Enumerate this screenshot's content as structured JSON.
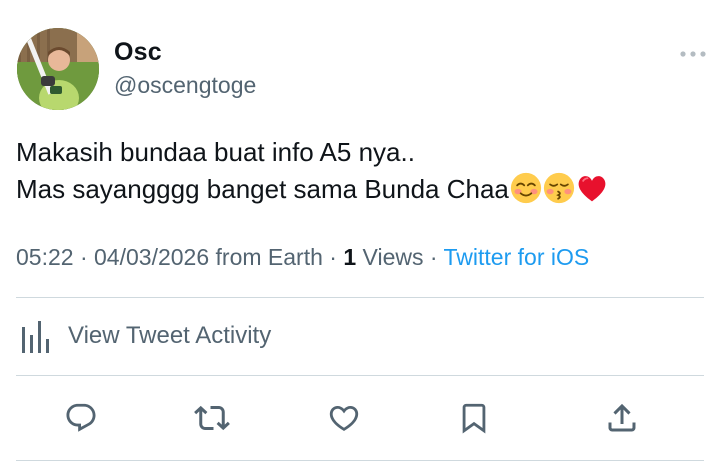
{
  "author": {
    "display_name": "Osc",
    "handle": "@oscengtoge"
  },
  "tweet": {
    "line1": "Makasih bundaa buat info A5 nya..",
    "line2": "Mas sayangggg banget sama Bunda Chaa",
    "emojis": [
      "smiling-face-emoji",
      "kissing-face-emoji",
      "red-heart-emoji"
    ]
  },
  "meta": {
    "time": "05:22",
    "separator": "·",
    "date": "04/03/2026",
    "location": "from Earth",
    "views_count": "1",
    "views_label": "Views",
    "source": "Twitter for iOS"
  },
  "activity": {
    "label": "View Tweet Activity"
  },
  "actions": [
    "reply-icon",
    "retweet-icon",
    "like-icon",
    "bookmark-icon",
    "share-icon"
  ],
  "colors": {
    "text": "#0f1419",
    "secondary": "#536471",
    "accent": "#1d9bf0",
    "divider": "#cfd9de",
    "heart": "#e8112d",
    "emoji_face": "#ffcc4d"
  }
}
